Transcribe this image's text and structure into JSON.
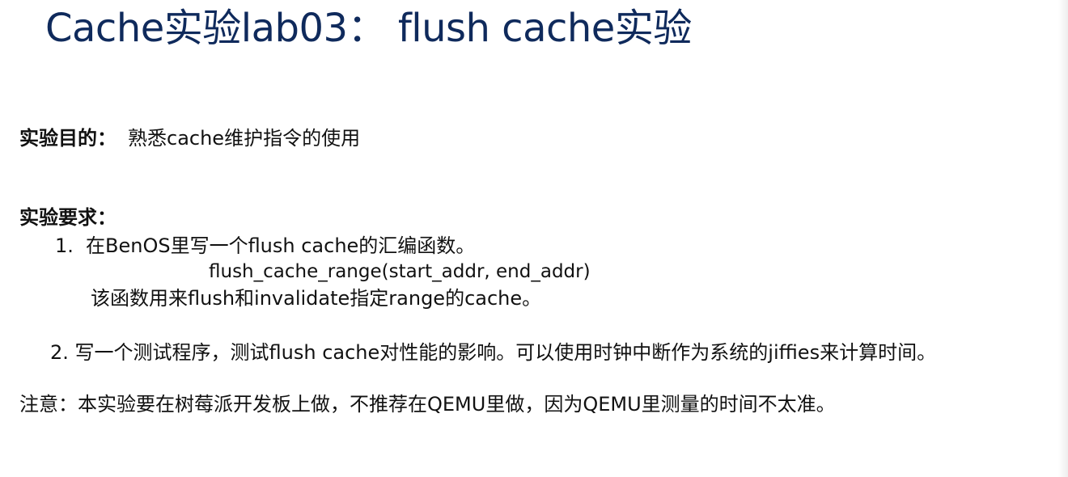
{
  "slide": {
    "title": "Cache实验lab03： flush cache实验",
    "purpose": {
      "label": "实验目的：",
      "text": "熟悉cache维护指令的使用"
    },
    "requirements": {
      "heading": "实验要求：",
      "item1": {
        "number": "1.",
        "text": "在BenOS里写一个flush cache的汇编函数。",
        "code": "flush_cache_range(start_addr, end_addr)",
        "description": "该函数用来flush和invalidate指定range的cache。"
      },
      "item2": {
        "text": "2. 写一个测试程序，测试flush cache对性能的影响。可以使用时钟中断作为系统的jiffies来计算时间。"
      }
    },
    "note": "注意：本实验要在树莓派开发板上做，不推荐在QEMU里做，因为QEMU里测量的时间不太准。"
  },
  "colors": {
    "title": "#0f2a5c",
    "text": "#111111",
    "background": "#ffffff"
  }
}
